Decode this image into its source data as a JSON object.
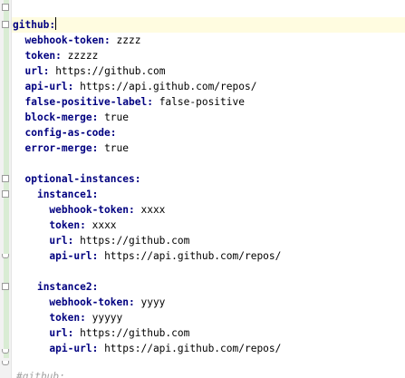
{
  "editor": {
    "lines": [
      {
        "indent": "",
        "key": "github",
        "sep": ":",
        "value": ""
      },
      {
        "indent": "  ",
        "key": "webhook-token",
        "sep": ": ",
        "value": "zzzz"
      },
      {
        "indent": "  ",
        "key": "token",
        "sep": ": ",
        "value": "zzzzz"
      },
      {
        "indent": "  ",
        "key": "url",
        "sep": ": ",
        "value": "https://github.com"
      },
      {
        "indent": "  ",
        "key": "api-url",
        "sep": ": ",
        "value": "https://api.github.com/repos/"
      },
      {
        "indent": "  ",
        "key": "false-positive-label",
        "sep": ": ",
        "value": "false-positive"
      },
      {
        "indent": "  ",
        "key": "block-merge",
        "sep": ": ",
        "value": "true"
      },
      {
        "indent": "  ",
        "key": "config-as-code",
        "sep": ":",
        "value": ""
      },
      {
        "indent": "  ",
        "key": "error-merge",
        "sep": ": ",
        "value": "true"
      },
      {
        "indent": "",
        "key": "",
        "sep": "",
        "value": ""
      },
      {
        "indent": "  ",
        "key": "optional-instances",
        "sep": ":",
        "value": ""
      },
      {
        "indent": "    ",
        "key": "instance1",
        "sep": ":",
        "value": ""
      },
      {
        "indent": "      ",
        "key": "webhook-token",
        "sep": ": ",
        "value": "xxxx"
      },
      {
        "indent": "      ",
        "key": "token",
        "sep": ": ",
        "value": "xxxx"
      },
      {
        "indent": "      ",
        "key": "url",
        "sep": ": ",
        "value": "https://github.com"
      },
      {
        "indent": "      ",
        "key": "api-url",
        "sep": ": ",
        "value": "https://api.github.com/repos/"
      },
      {
        "indent": "",
        "key": "",
        "sep": "",
        "value": ""
      },
      {
        "indent": "    ",
        "key": "instance2",
        "sep": ":",
        "value": ""
      },
      {
        "indent": "      ",
        "key": "webhook-token",
        "sep": ": ",
        "value": "yyyy"
      },
      {
        "indent": "      ",
        "key": "token",
        "sep": ": ",
        "value": "yyyyy"
      },
      {
        "indent": "      ",
        "key": "url",
        "sep": ": ",
        "value": "https://github.com"
      },
      {
        "indent": "      ",
        "key": "api-url",
        "sep": ": ",
        "value": "https://api.github.com/repos/"
      }
    ],
    "ghost_text": "#github:"
  }
}
